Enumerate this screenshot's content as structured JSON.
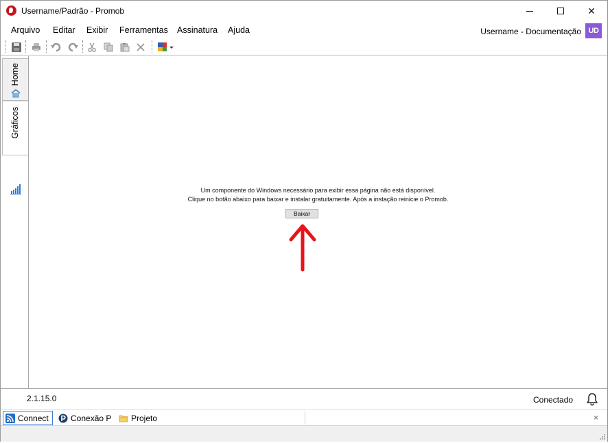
{
  "window": {
    "title": "Username/Padrão - Promob",
    "controls": {
      "minimize": "minimize",
      "maximize": "maximize",
      "close": "✕"
    }
  },
  "menu": {
    "items": [
      "Arquivo",
      "Editar",
      "Exibir",
      "Ferramentas",
      "Assinatura",
      "Ajuda"
    ],
    "user_label": "Username - Documentação",
    "user_initials": "UD"
  },
  "toolbar": {
    "icons": [
      "save-icon",
      "print-icon",
      "undo-icon",
      "redo-icon",
      "cut-icon",
      "copy-icon",
      "paste-icon",
      "delete-icon",
      "color-palette-icon"
    ]
  },
  "sidetabs": [
    {
      "label": "Home",
      "icon": "home-icon"
    },
    {
      "label": "Gráficos",
      "icon": "chart-bars-icon"
    }
  ],
  "content": {
    "message_line1": "Um componente do Windows necessário para exibir essa página não está disponível.",
    "message_line2": "Clique no botão abaixo para baixar e instalar gratuitamente. Após a instação reinicie o Promob.",
    "button_label": "Baixar",
    "annotation_color": "#e8141b"
  },
  "status": {
    "version": "2.1.15.0",
    "connection": "Conectado"
  },
  "bottom_tabs": [
    {
      "label": "Connect",
      "icon": "rss-icon"
    },
    {
      "label": "Conexão P",
      "icon": "promob-p-icon"
    },
    {
      "label": "Projeto",
      "icon": "folder-icon"
    }
  ],
  "bottom_close": "×"
}
